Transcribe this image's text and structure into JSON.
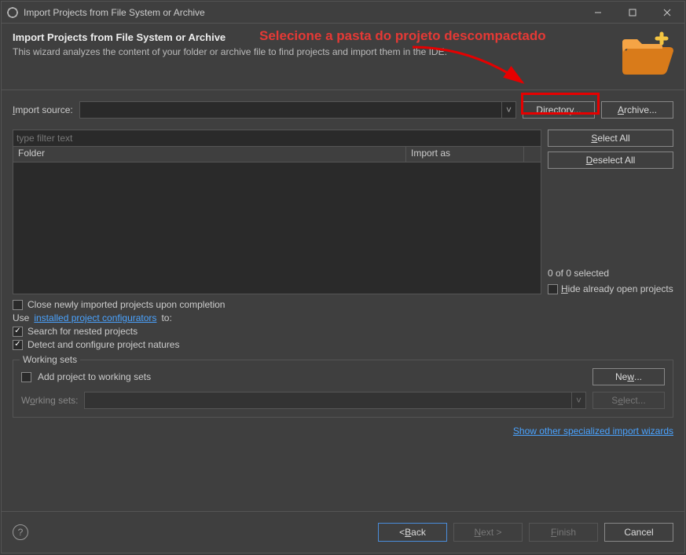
{
  "titlebar": {
    "title": "Import Projects from File System or Archive"
  },
  "annotation": {
    "text": "Selecione a pasta do projeto descompactado"
  },
  "header": {
    "title": "Import Projects from File System or Archive",
    "subtitle": "This wizard analyzes the content of your folder or archive file to find projects and import them in the IDE."
  },
  "source_row": {
    "label": "Import source:",
    "value": "",
    "directory_btn": "Directory...",
    "archive_btn": "Archive..."
  },
  "filter": {
    "placeholder": "type filter text"
  },
  "table": {
    "col_folder": "Folder",
    "col_importas": "Import as"
  },
  "side_buttons": {
    "select_all": "Select All",
    "deselect_all": "Deselect All"
  },
  "selection_status": "0 of 0 selected",
  "hide_checkbox": "Hide already open projects",
  "options": {
    "close_newly": "Close newly imported projects upon completion",
    "use_prefix": "Use ",
    "configurators_link": "installed project configurators",
    "use_suffix": " to:",
    "search_nested": "Search for nested projects",
    "detect_natures": "Detect and configure project natures"
  },
  "working_sets": {
    "legend": "Working sets",
    "add_label": "Add project to working sets",
    "new_btn": "New...",
    "ws_label": "Working sets:",
    "select_btn": "Select..."
  },
  "specialized_link": "Show other specialized import wizards",
  "footer": {
    "back": "< Back",
    "next": "Next >",
    "finish": "Finish",
    "cancel": "Cancel"
  }
}
